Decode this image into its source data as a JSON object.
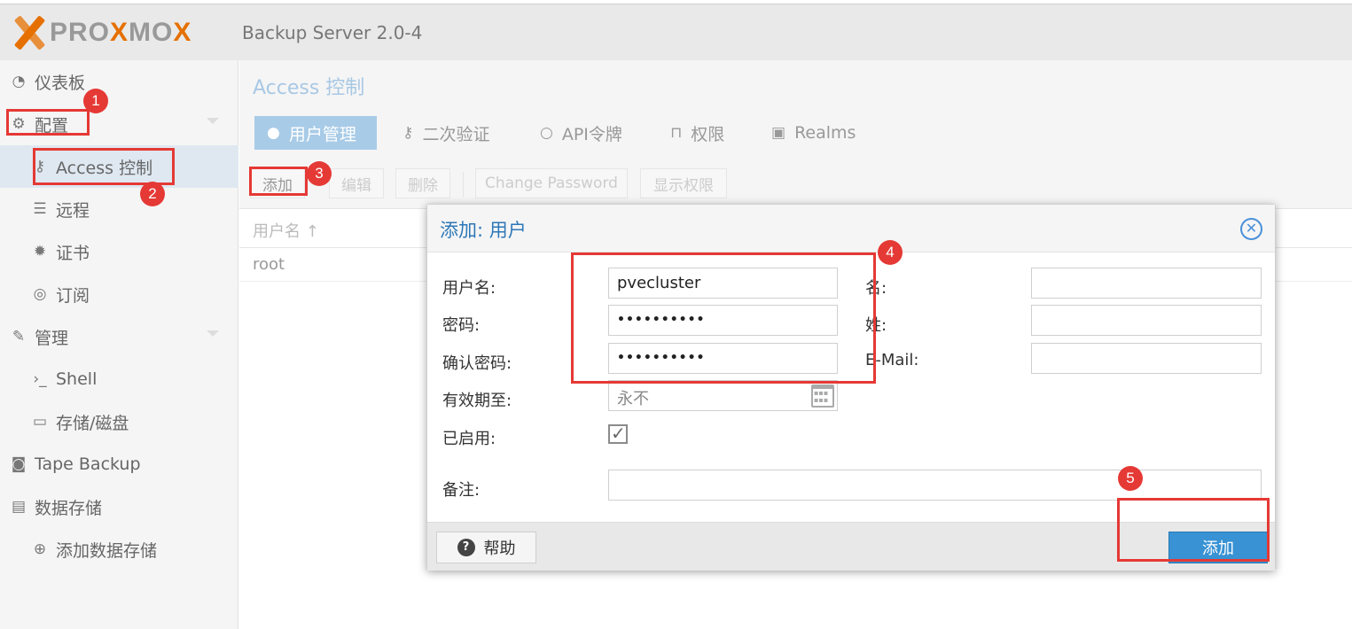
{
  "header": {
    "logo_text_a": "PRO",
    "logo_text_b": "X",
    "logo_text_c": "MO",
    "logo_text_d": "X",
    "app_title": "Backup Server 2.0-4"
  },
  "sidebar": {
    "items": [
      {
        "label": "仪表板",
        "icon": "dashboard-icon"
      },
      {
        "label": "配置",
        "icon": "gears-icon"
      },
      {
        "label": "Access 控制",
        "icon": "key-icon"
      },
      {
        "label": "远程",
        "icon": "server-icon"
      },
      {
        "label": "证书",
        "icon": "certificate-icon"
      },
      {
        "label": "订阅",
        "icon": "lifebuoy-icon"
      },
      {
        "label": "管理",
        "icon": "wrench-icon"
      },
      {
        "label": "Shell",
        "icon": "terminal-icon"
      },
      {
        "label": "存储/磁盘",
        "icon": "hdd-icon"
      },
      {
        "label": "Tape Backup",
        "icon": "tape-icon"
      },
      {
        "label": "数据存储",
        "icon": "archive-icon"
      },
      {
        "label": "添加数据存储",
        "icon": "plus-circle-icon"
      }
    ]
  },
  "main": {
    "title": "Access 控制",
    "tabs": [
      {
        "label": "用户管理",
        "icon": "user-icon"
      },
      {
        "label": "二次验证",
        "icon": "key-icon"
      },
      {
        "label": "API令牌",
        "icon": "user-outline-icon"
      },
      {
        "label": "权限",
        "icon": "unlock-icon"
      },
      {
        "label": "Realms",
        "icon": "address-book-icon"
      }
    ],
    "toolbar": {
      "add": "添加",
      "edit": "编辑",
      "delete": "删除",
      "change_password": "Change Password",
      "show_permissions": "显示权限"
    },
    "grid": {
      "column_username": "用户名 ↑",
      "rows": [
        "root"
      ]
    }
  },
  "dialog": {
    "title": "添加: 用户",
    "labels": {
      "username": "用户名:",
      "password": "密码:",
      "confirm_password": "确认密码:",
      "expire": "有效期至:",
      "enabled": "已启用:",
      "comment": "备注:",
      "first_name": "名:",
      "last_name": "姓:",
      "email": "E-Mail:"
    },
    "values": {
      "username": "pvecluster",
      "password": "••••••••••",
      "confirm_password": "••••••••••",
      "expire": "永不",
      "first_name": "",
      "last_name": "",
      "email": "",
      "comment": ""
    },
    "enabled_checked": true,
    "help_button": "帮助",
    "add_button": "添加"
  },
  "annotations": [
    "1",
    "2",
    "3",
    "4",
    "5"
  ],
  "colors": {
    "accent": "#3892d4",
    "annotation": "#e53935",
    "brand": "#e57000"
  }
}
